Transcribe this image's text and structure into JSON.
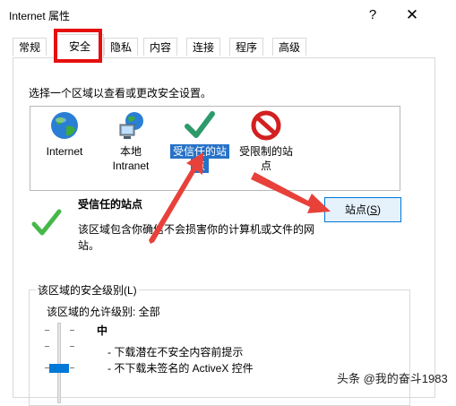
{
  "window": {
    "title": "Internet 属性",
    "help": "?",
    "close": "✕"
  },
  "tabs": [
    "常规",
    "安全",
    "隐私",
    "内容",
    "连接",
    "程序",
    "高级"
  ],
  "active_tab": "安全",
  "prompt": "选择一个区域以查看或更改安全设置。",
  "zones": [
    {
      "line1": "Internet",
      "line2": ""
    },
    {
      "line1": "本地",
      "line2": "Intranet"
    },
    {
      "line1": "受信任的站",
      "line2": "点"
    },
    {
      "line1": "受限制的站",
      "line2": "点"
    }
  ],
  "selected_zone": "受信任的站点",
  "detail": {
    "title": "受信任的站点",
    "description": "该区域包含你确信不会损害你的计算机或文件的网站。"
  },
  "sites_button": {
    "label": "站点(",
    "mnemonic": "S",
    "suffix": ")"
  },
  "security_level": {
    "group_label": "该区域的安全级别(L)",
    "allowed": "该区域的允许级别: 全部",
    "level": "中",
    "bullets": [
      "- 下载潜在不安全内容前提示",
      "- 不下载未签名的 ActiveX 控件"
    ]
  },
  "watermark": "头条 @我的奋斗1983",
  "colors": {
    "highlight": "#e60f0f",
    "selection": "#2672c8",
    "accent": "#0078d7",
    "arrow": "#e8413a"
  }
}
